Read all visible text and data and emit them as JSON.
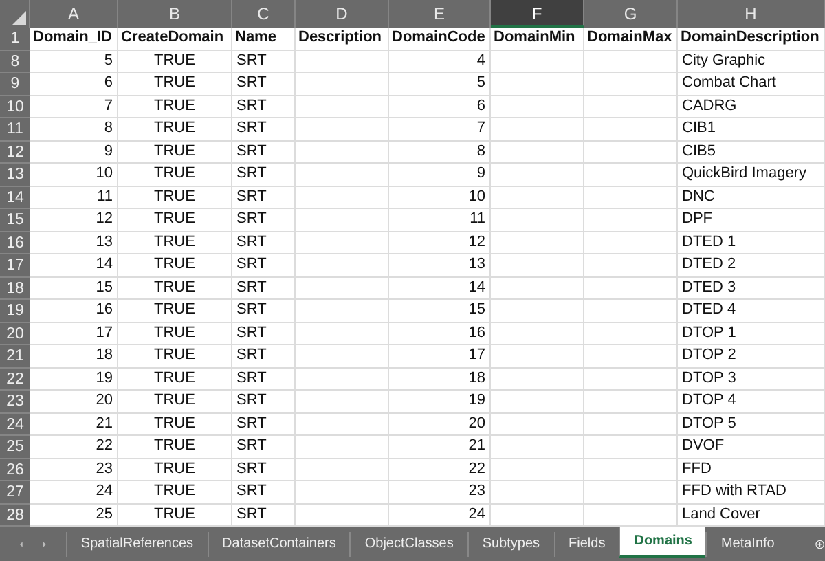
{
  "columns": [
    {
      "letter": "A",
      "selected": false
    },
    {
      "letter": "B",
      "selected": false
    },
    {
      "letter": "C",
      "selected": false
    },
    {
      "letter": "D",
      "selected": false
    },
    {
      "letter": "E",
      "selected": false
    },
    {
      "letter": "F",
      "selected": true
    },
    {
      "letter": "G",
      "selected": false
    },
    {
      "letter": "H",
      "selected": false
    }
  ],
  "header_row": {
    "row": "1",
    "cells": [
      "Domain_ID",
      "CreateDomain",
      "Name",
      "Description",
      "DomainCode",
      "DomainMin",
      "DomainMax",
      "DomainDescription"
    ]
  },
  "rows": [
    {
      "row": "8",
      "cells": [
        "5",
        "TRUE",
        "SRT",
        "",
        "4",
        "",
        "",
        "City Graphic"
      ]
    },
    {
      "row": "9",
      "cells": [
        "6",
        "TRUE",
        "SRT",
        "",
        "5",
        "",
        "",
        "Combat Chart"
      ]
    },
    {
      "row": "10",
      "cells": [
        "7",
        "TRUE",
        "SRT",
        "",
        "6",
        "",
        "",
        "CADRG"
      ]
    },
    {
      "row": "11",
      "cells": [
        "8",
        "TRUE",
        "SRT",
        "",
        "7",
        "",
        "",
        "CIB1"
      ]
    },
    {
      "row": "12",
      "cells": [
        "9",
        "TRUE",
        "SRT",
        "",
        "8",
        "",
        "",
        "CIB5"
      ]
    },
    {
      "row": "13",
      "cells": [
        "10",
        "TRUE",
        "SRT",
        "",
        "9",
        "",
        "",
        "QuickBird Imagery"
      ]
    },
    {
      "row": "14",
      "cells": [
        "11",
        "TRUE",
        "SRT",
        "",
        "10",
        "",
        "",
        "DNC"
      ]
    },
    {
      "row": "15",
      "cells": [
        "12",
        "TRUE",
        "SRT",
        "",
        "11",
        "",
        "",
        "DPF"
      ]
    },
    {
      "row": "16",
      "cells": [
        "13",
        "TRUE",
        "SRT",
        "",
        "12",
        "",
        "",
        "DTED 1"
      ]
    },
    {
      "row": "17",
      "cells": [
        "14",
        "TRUE",
        "SRT",
        "",
        "13",
        "",
        "",
        "DTED 2"
      ]
    },
    {
      "row": "18",
      "cells": [
        "15",
        "TRUE",
        "SRT",
        "",
        "14",
        "",
        "",
        "DTED 3"
      ]
    },
    {
      "row": "19",
      "cells": [
        "16",
        "TRUE",
        "SRT",
        "",
        "15",
        "",
        "",
        "DTED 4"
      ]
    },
    {
      "row": "20",
      "cells": [
        "17",
        "TRUE",
        "SRT",
        "",
        "16",
        "",
        "",
        "DTOP 1"
      ]
    },
    {
      "row": "21",
      "cells": [
        "18",
        "TRUE",
        "SRT",
        "",
        "17",
        "",
        "",
        "DTOP 2"
      ]
    },
    {
      "row": "22",
      "cells": [
        "19",
        "TRUE",
        "SRT",
        "",
        "18",
        "",
        "",
        "DTOP 3"
      ]
    },
    {
      "row": "23",
      "cells": [
        "20",
        "TRUE",
        "SRT",
        "",
        "19",
        "",
        "",
        "DTOP 4"
      ]
    },
    {
      "row": "24",
      "cells": [
        "21",
        "TRUE",
        "SRT",
        "",
        "20",
        "",
        "",
        "DTOP 5"
      ]
    },
    {
      "row": "25",
      "cells": [
        "22",
        "TRUE",
        "SRT",
        "",
        "21",
        "",
        "",
        "DVOF"
      ]
    },
    {
      "row": "26",
      "cells": [
        "23",
        "TRUE",
        "SRT",
        "",
        "22",
        "",
        "",
        "FFD"
      ]
    },
    {
      "row": "27",
      "cells": [
        "24",
        "TRUE",
        "SRT",
        "",
        "23",
        "",
        "",
        "FFD with RTAD"
      ]
    },
    {
      "row": "28",
      "cells": [
        "25",
        "TRUE",
        "SRT",
        "",
        "24",
        "",
        "",
        "Land Cover"
      ]
    }
  ],
  "sheet_tabs": [
    {
      "label": "SpatialReferences",
      "selected": false
    },
    {
      "label": "DatasetContainers",
      "selected": false
    },
    {
      "label": "ObjectClasses",
      "selected": false
    },
    {
      "label": "Subtypes",
      "selected": false
    },
    {
      "label": "Fields",
      "selected": false
    },
    {
      "label": "Domains",
      "selected": true
    },
    {
      "label": "MetaInfo",
      "selected": false
    }
  ]
}
